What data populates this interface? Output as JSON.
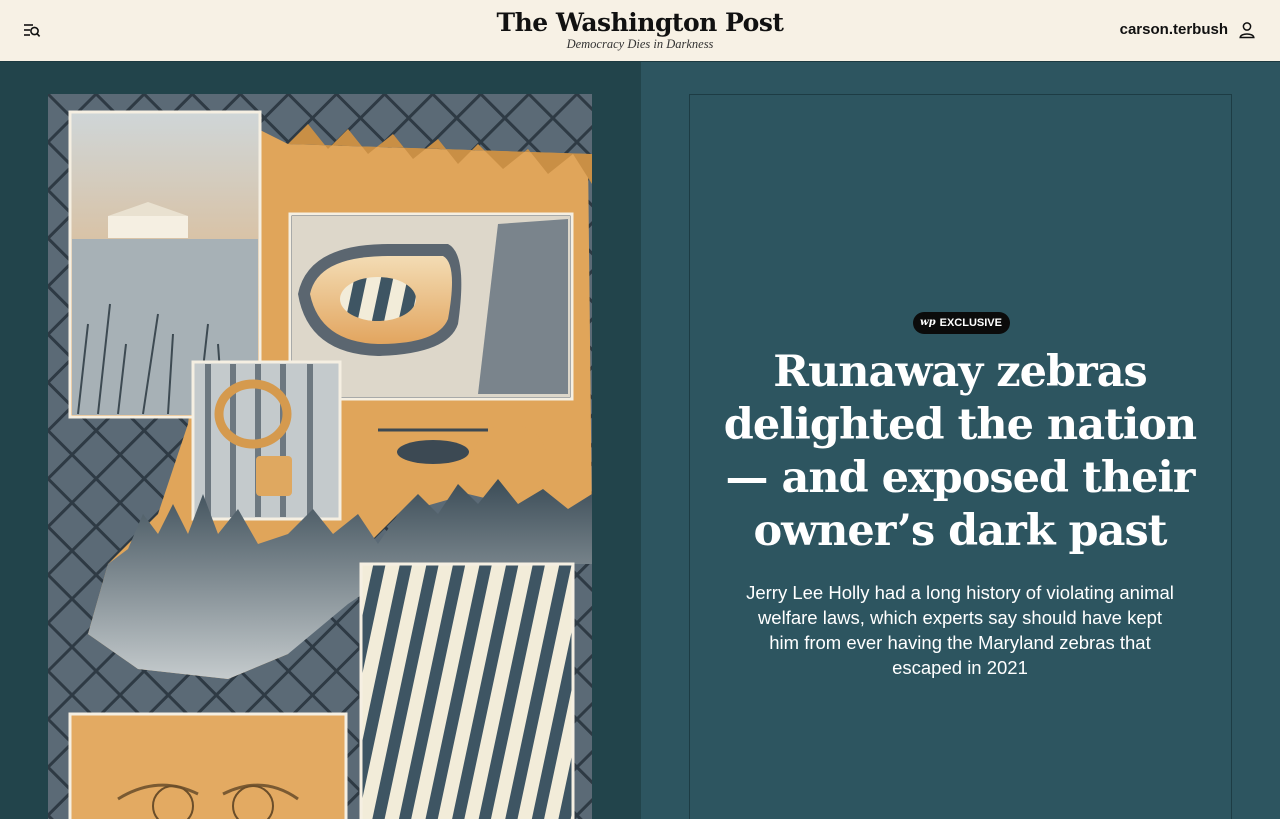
{
  "header": {
    "menu_icon": "menu-search-icon",
    "masthead": "The Washington Post",
    "tagline": "Democracy Dies in Darkness",
    "username": "carson.terbush",
    "user_icon": "user-icon"
  },
  "article": {
    "badge_logo": "wp",
    "badge_label": "EXCLUSIVE",
    "headline": "Runaway zebras delighted the nation — and exposed their owner’s dark past",
    "dek": "Jerry Lee Holly had a long history of violating animal welfare laws, which experts say should have kept him from ever having the Maryland zebras that escaped in 2021"
  },
  "colors": {
    "header_bg": "#f7f1e5",
    "panel_teal": "#2d5560",
    "art_dark": "#22444b",
    "accent_gold": "#e0a55a",
    "badge_black": "#0b0b0b"
  }
}
